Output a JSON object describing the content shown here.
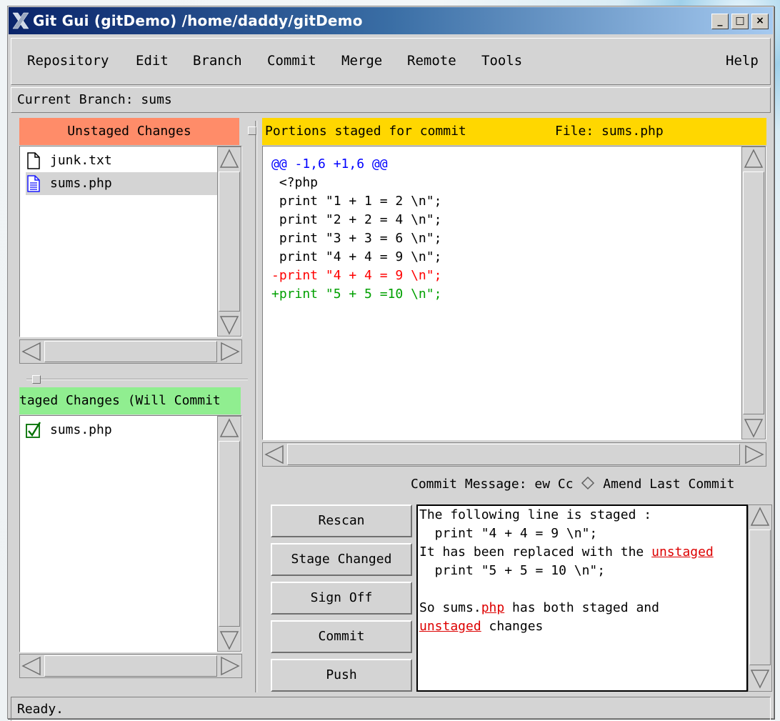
{
  "window": {
    "title": "Git Gui (gitDemo) /home/daddy/gitDemo",
    "controls": {
      "minimize": "_",
      "maximize": "□",
      "close": "×"
    }
  },
  "menu": {
    "items": [
      "Repository",
      "Edit",
      "Branch",
      "Commit",
      "Merge",
      "Remote",
      "Tools"
    ],
    "help": "Help"
  },
  "branch": {
    "label": "Current Branch: sums"
  },
  "unstaged": {
    "header": "Unstaged Changes",
    "header_color": "#ff8c69",
    "files": [
      {
        "name": "junk.txt",
        "icon": "file-plain-icon",
        "selected": false
      },
      {
        "name": "sums.php",
        "icon": "file-modified-icon",
        "selected": true
      }
    ]
  },
  "staged": {
    "header": "taged Changes (Will Commit",
    "header_color": "#90ee90",
    "files": [
      {
        "name": "sums.php",
        "icon": "file-staged-check-icon"
      }
    ]
  },
  "diff": {
    "header_left": "Portions staged for commit",
    "header_right": "File: sums.php",
    "header_color": "#ffd700",
    "lines": [
      {
        "text": "@@ -1,6 +1,6 @@",
        "color": "#0000ff"
      },
      {
        "text": " <?php",
        "color": "#000000"
      },
      {
        "text": " print \"1 + 1 = 2 \\n\";",
        "color": "#000000"
      },
      {
        "text": " print \"2 + 2 = 4 \\n\";",
        "color": "#000000"
      },
      {
        "text": " print \"3 + 3 = 6 \\n\";",
        "color": "#000000"
      },
      {
        "text": " print \"4 + 4 = 9 \\n\";",
        "color": "#000000"
      },
      {
        "text": "-print \"4 + 4 = 9 \\n\";",
        "color": "#ff0000"
      },
      {
        "text": "+print \"5 + 5 =10 \\n\";",
        "color": "#00a000"
      }
    ]
  },
  "commit": {
    "message_label": "Commit Message:",
    "new_commit_label": "ew Cc",
    "amend_label": "Amend Last Commit",
    "buttons": [
      "Rescan",
      "Stage Changed",
      "Sign Off",
      "Commit",
      "Push"
    ],
    "message": {
      "line1": "The following line is staged :",
      "line2": "  print \"4 + 4 = 9 \\n\";",
      "line3a": "It has been replaced with the ",
      "line3b": "unstaged",
      "line4": "  print \"5 + 5 = 10 \\n\";",
      "line5": "",
      "line6a": "So sums.",
      "line6b": "php",
      "line6c": " has both staged and",
      "line7a": "unstaged",
      "line7b": " changes"
    }
  },
  "status": {
    "text": "Ready."
  }
}
